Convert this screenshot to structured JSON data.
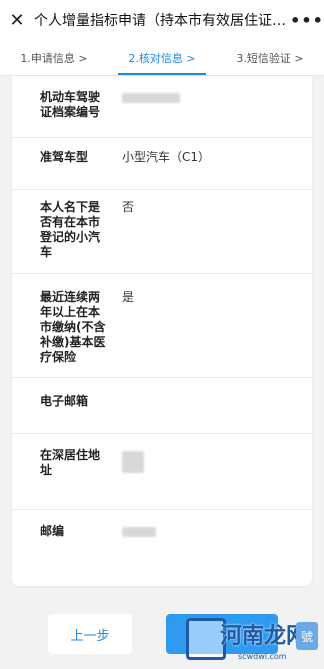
{
  "window": {
    "title": "个人增量指标申请（持本市有效居住证的...",
    "close_icon": "close-icon",
    "more_icon": "more-icon",
    "more_glyph": "•••"
  },
  "steps": [
    {
      "label": "1.申请信息 >",
      "active": false
    },
    {
      "label": "2.核对信息 >",
      "active": true
    },
    {
      "label": "3.短信验证 >",
      "active": false
    }
  ],
  "fields": [
    {
      "label": "机动车驾驶证档案编号",
      "value": "",
      "redacted": true
    },
    {
      "label": "准驾车型",
      "value": "小型汽车（C1）",
      "redacted": false
    },
    {
      "label": "本人名下是否有在本市登记的小汽车",
      "value": "否",
      "redacted": false
    },
    {
      "label": "最近连续两年以上在本市缴纳(不含补缴)基本医疗保险",
      "value": "是",
      "redacted": false
    },
    {
      "label": "电子邮箱",
      "value": "",
      "redacted": false
    },
    {
      "label": "在深居住地址",
      "value": "",
      "redacted": true
    },
    {
      "label": "邮编",
      "value": "",
      "redacted": true
    }
  ],
  "buttons": {
    "prev_label": "上一步",
    "next_label": ""
  },
  "watermark": {
    "text": "河南龙网",
    "url": "scwdwl.com",
    "tag": "號"
  },
  "colors": {
    "accent": "#1e88e5",
    "next_button": "#2e9bf0"
  }
}
